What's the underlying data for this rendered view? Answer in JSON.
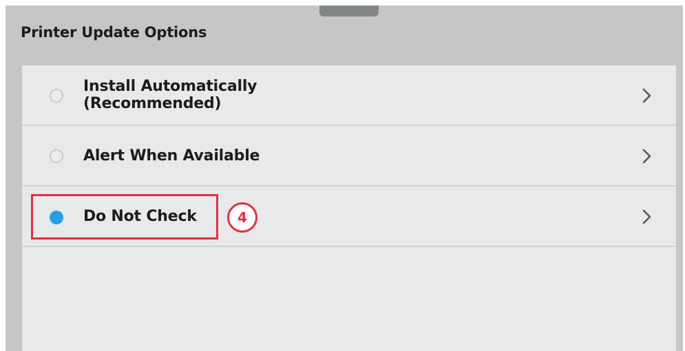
{
  "header": {
    "title": "Printer Update Options"
  },
  "options": [
    {
      "label_line1": "Install Automatically",
      "label_line2": "(Recommended)",
      "selected": false
    },
    {
      "label": "Alert When Available",
      "selected": false
    },
    {
      "label": "Do Not Check",
      "selected": true
    }
  ],
  "annotation": {
    "step_number": "4"
  },
  "colors": {
    "selected_radio": "#2a9ee4",
    "highlight": "#e0303d"
  },
  "icons": {
    "option_arrow": "chevron-right-icon"
  }
}
